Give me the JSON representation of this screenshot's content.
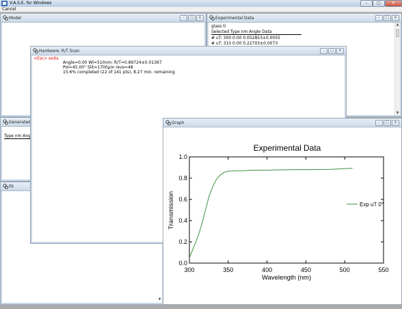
{
  "app": {
    "title": "V.A.S.E. for Windows",
    "menu": [
      "Cancel"
    ],
    "controls": {
      "minimize": "–",
      "maximize": "□",
      "close": "✕"
    }
  },
  "windows": {
    "model": {
      "title": "Model"
    },
    "experimental": {
      "title": "Experimental Data",
      "name": "glass ti",
      "header": "Selected Type  nm  Angle  Data",
      "rows": [
        "# uT: 300  0.00 0.052853±0.0055",
        "# uT: 310  0.00 0.22703±0.0073"
      ]
    },
    "generated": {
      "title": "Generated Da",
      "header": "Type  nm  Ang"
    },
    "fit": {
      "title": "Fit"
    },
    "scan": {
      "title": "Hardware: R/T Scan",
      "esc": "<Esc> exits",
      "line1": "Angle=0.00   Wl=510nm:    R/T=0.89724±0.01397",
      "line2": "Pol=45.00°   Slit=1700µm  revs=48",
      "line3": "15.6% completed (22 of 141 pts), 8.27 min. remaining"
    },
    "graph": {
      "title": "Graph"
    }
  },
  "chart_data": {
    "type": "line",
    "title": "Experimental Data",
    "xlabel": "Wavelength (nm)",
    "ylabel": "Transmission",
    "xlim": [
      300,
      550
    ],
    "ylim": [
      0.0,
      1.0
    ],
    "xticks": [
      300,
      350,
      400,
      450,
      500,
      550
    ],
    "yticks": [
      0.0,
      0.2,
      0.4,
      0.6,
      0.8,
      1.0
    ],
    "xtick_labels": [
      "300",
      "350",
      "400",
      "450",
      "500",
      "550"
    ],
    "ytick_labels": [
      "0.0",
      "0.2",
      "0.4",
      "0.6",
      "0.8",
      "1.0"
    ],
    "legend_position": "right",
    "series": [
      {
        "name": "Exp uT 0°",
        "color": "#3f8f3f",
        "x": [
          300,
          305,
          310,
          315,
          320,
          325,
          330,
          335,
          340,
          345,
          350,
          360,
          370,
          380,
          400,
          420,
          440,
          460,
          480,
          500,
          510
        ],
        "y": [
          0.05,
          0.14,
          0.23,
          0.34,
          0.48,
          0.62,
          0.72,
          0.79,
          0.83,
          0.855,
          0.865,
          0.87,
          0.87,
          0.875,
          0.875,
          0.878,
          0.88,
          0.88,
          0.882,
          0.89,
          0.893
        ]
      }
    ]
  }
}
